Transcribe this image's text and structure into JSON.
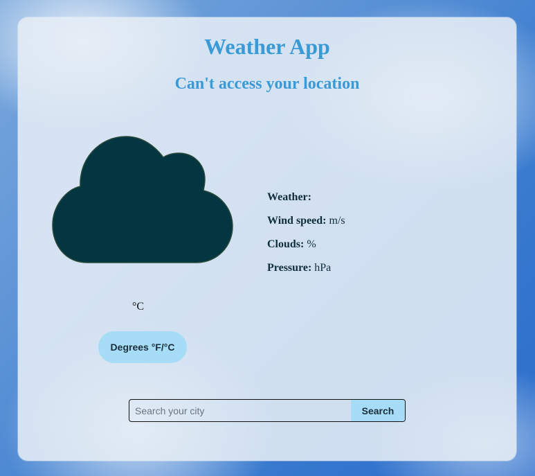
{
  "app": {
    "title": "Weather App",
    "status": "Can't access your location"
  },
  "current": {
    "icon": "cloud-icon",
    "icon_color": "#043642",
    "temperature_unit": "°C",
    "unit_toggle_label": "Degrees °F/°C"
  },
  "details": {
    "weather_label": "Weather:",
    "weather_value": "",
    "wind_label": "Wind speed:",
    "wind_unit": "m/s",
    "clouds_label": "Clouds:",
    "clouds_unit": "%",
    "pressure_label": "Pressure:",
    "pressure_unit": "hPa"
  },
  "search": {
    "placeholder": "Search your city",
    "button_label": "Search"
  },
  "colors": {
    "accent": "#3a9ad6",
    "button": "#a6dcf6"
  }
}
